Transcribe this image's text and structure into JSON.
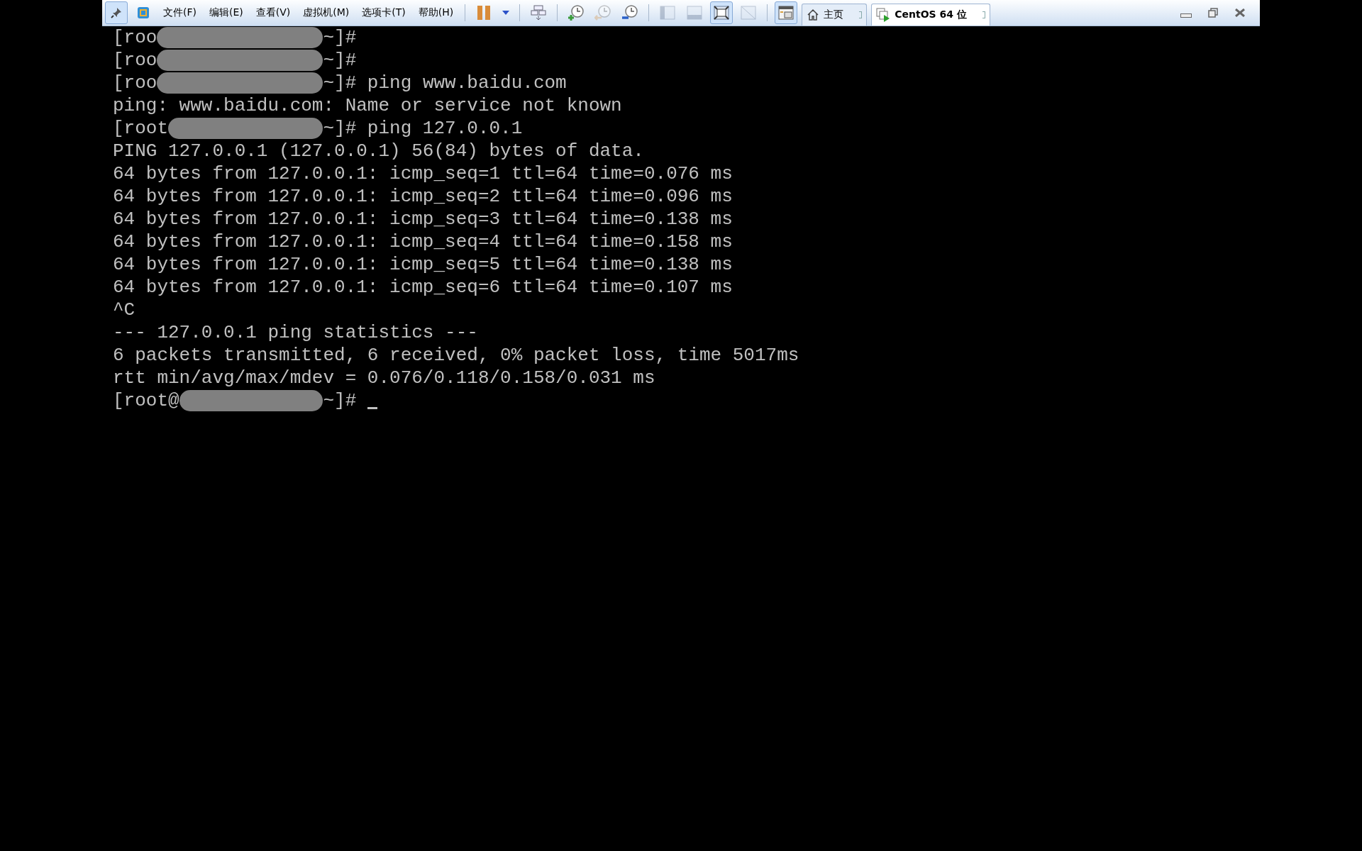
{
  "toolbar": {
    "items": [
      {
        "kind": "pin",
        "on": true,
        "disabled": false
      },
      {
        "kind": "app",
        "on": false,
        "disabled": false
      },
      {
        "kind": "menu",
        "label": "文件(F)"
      },
      {
        "kind": "menu",
        "label": "编辑(E)"
      },
      {
        "kind": "menu",
        "label": "查看(V)"
      },
      {
        "kind": "menu",
        "label": "虚拟机(M)"
      },
      {
        "kind": "menu",
        "label": "选项卡(T)"
      },
      {
        "kind": "menu",
        "label": "帮助(H)"
      },
      {
        "kind": "sep"
      },
      {
        "kind": "pause",
        "on": false,
        "disabled": false
      },
      {
        "kind": "caret",
        "on": false,
        "disabled": false
      },
      {
        "kind": "sep"
      },
      {
        "kind": "keys",
        "on": false,
        "disabled": false
      },
      {
        "kind": "sep"
      },
      {
        "kind": "snapshot-take",
        "on": false,
        "disabled": false
      },
      {
        "kind": "snapshot-revert",
        "on": false,
        "disabled": true
      },
      {
        "kind": "snapshot-manage",
        "on": false,
        "disabled": false
      },
      {
        "kind": "sep"
      },
      {
        "kind": "view-sidebar",
        "on": false,
        "disabled": true
      },
      {
        "kind": "view-bottom",
        "on": false,
        "disabled": true
      },
      {
        "kind": "view-full",
        "on": true,
        "disabled": false
      },
      {
        "kind": "view-unity",
        "on": false,
        "disabled": true
      },
      {
        "kind": "sep"
      },
      {
        "kind": "library",
        "on": true,
        "disabled": false
      }
    ],
    "tabs": [
      {
        "label": "主页",
        "kind": "home",
        "selected": false
      },
      {
        "label": "CentOS 64 位",
        "kind": "vm",
        "selected": true
      }
    ]
  },
  "terminal": {
    "lines": [
      {
        "kind": "prompt",
        "before": "[roo",
        "after": "~]#"
      },
      {
        "kind": "prompt",
        "before": "[roo",
        "after": "~]#"
      },
      {
        "kind": "prompt",
        "before": "[roo",
        "after": "~]# ping www.baidu.com"
      },
      {
        "kind": "text",
        "text": "ping: www.baidu.com: Name or service not known"
      },
      {
        "kind": "prompt",
        "before": "[root",
        "after": "~]# ping 127.0.0.1"
      },
      {
        "kind": "text",
        "text": "PING 127.0.0.1 (127.0.0.1) 56(84) bytes of data."
      },
      {
        "kind": "text",
        "text": "64 bytes from 127.0.0.1: icmp_seq=1 ttl=64 time=0.076 ms"
      },
      {
        "kind": "text",
        "text": "64 bytes from 127.0.0.1: icmp_seq=2 ttl=64 time=0.096 ms"
      },
      {
        "kind": "text",
        "text": "64 bytes from 127.0.0.1: icmp_seq=3 ttl=64 time=0.138 ms"
      },
      {
        "kind": "text",
        "text": "64 bytes from 127.0.0.1: icmp_seq=4 ttl=64 time=0.158 ms"
      },
      {
        "kind": "text",
        "text": "64 bytes from 127.0.0.1: icmp_seq=5 ttl=64 time=0.138 ms"
      },
      {
        "kind": "text",
        "text": "64 bytes from 127.0.0.1: icmp_seq=6 ttl=64 time=0.107 ms"
      },
      {
        "kind": "text",
        "text": "^C"
      },
      {
        "kind": "text",
        "text": "--- 127.0.0.1 ping statistics ---"
      },
      {
        "kind": "text",
        "text": "6 packets transmitted, 6 received, 0% packet loss, time 5017ms"
      },
      {
        "kind": "text",
        "text": "rtt min/avg/max/mdev = 0.076/0.118/0.158/0.031 ms"
      },
      {
        "kind": "prompt",
        "before": "[root@",
        "after": "~]#",
        "cursor": true
      }
    ]
  }
}
